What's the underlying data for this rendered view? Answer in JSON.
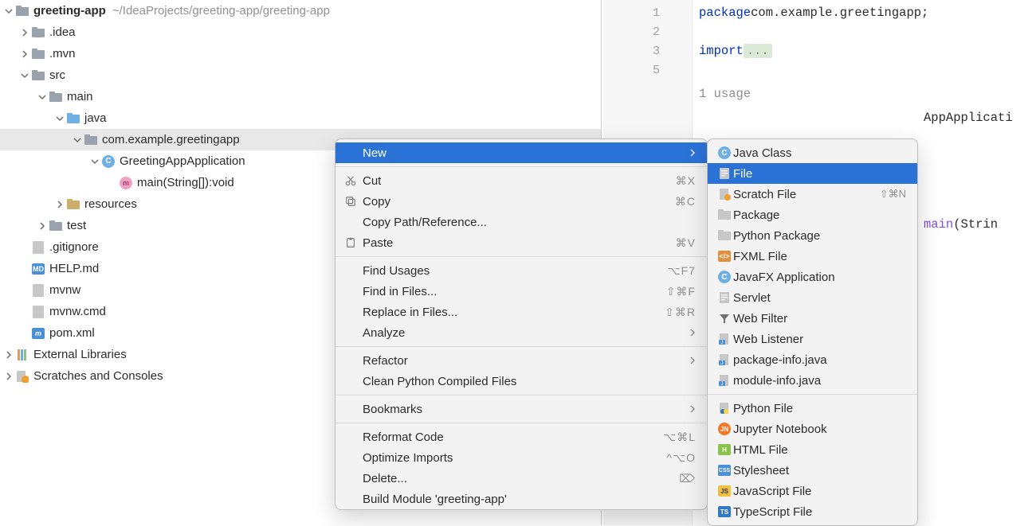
{
  "tree": {
    "root": {
      "name": "greeting-app",
      "path": "~/IdeaProjects/greeting-app/greeting-app"
    },
    "items": [
      {
        "label": ".idea"
      },
      {
        "label": ".mvn"
      },
      {
        "label": "src"
      },
      {
        "label": "main"
      },
      {
        "label": "java"
      },
      {
        "label": "com.example.greetingapp"
      },
      {
        "label": "GreetingAppApplication"
      },
      {
        "label": "main(String[]):void"
      },
      {
        "label": "resources"
      },
      {
        "label": "test"
      },
      {
        "label": ".gitignore"
      },
      {
        "label": "HELP.md"
      },
      {
        "label": "mvnw"
      },
      {
        "label": "mvnw.cmd"
      },
      {
        "label": "pom.xml"
      },
      {
        "label": "External Libraries"
      },
      {
        "label": "Scratches and Consoles"
      }
    ]
  },
  "editor": {
    "lines": [
      "1",
      "2",
      "3",
      "5"
    ],
    "code": {
      "l1a": "package",
      "l1b": " com.example.greetingapp;",
      "l3a": "import ",
      "l3b": "...",
      "usage": "1 usage",
      "l6": "AppApplicati",
      "l8a": " main",
      "l8b": "(Strin"
    }
  },
  "contextMenu": {
    "items": [
      {
        "label": "New",
        "arrow": true,
        "highlight": true
      },
      {
        "sep": true
      },
      {
        "label": "Cut",
        "shortcut": "⌘X",
        "icon": "cut"
      },
      {
        "label": "Copy",
        "shortcut": "⌘C",
        "icon": "copy"
      },
      {
        "label": "Copy Path/Reference..."
      },
      {
        "label": "Paste",
        "shortcut": "⌘V",
        "icon": "paste"
      },
      {
        "sep": true
      },
      {
        "label": "Find Usages",
        "shortcut": "⌥F7"
      },
      {
        "label": "Find in Files...",
        "shortcut": "⇧⌘F"
      },
      {
        "label": "Replace in Files...",
        "shortcut": "⇧⌘R"
      },
      {
        "label": "Analyze",
        "arrow": true
      },
      {
        "sep": true
      },
      {
        "label": "Refactor",
        "arrow": true
      },
      {
        "label": "Clean Python Compiled Files"
      },
      {
        "sep": true
      },
      {
        "label": "Bookmarks",
        "arrow": true
      },
      {
        "sep": true
      },
      {
        "label": "Reformat Code",
        "shortcut": "⌥⌘L"
      },
      {
        "label": "Optimize Imports",
        "shortcut": "^⌥O"
      },
      {
        "label": "Delete...",
        "shortcut": "⌦"
      },
      {
        "label": "Build Module 'greeting-app'"
      }
    ]
  },
  "submenu": {
    "items": [
      {
        "label": "Java Class",
        "icon": "c-circ"
      },
      {
        "label": "File",
        "highlight": true,
        "icon": "file"
      },
      {
        "label": "Scratch File",
        "shortcut": "⇧⌘N",
        "icon": "file-dot"
      },
      {
        "label": "Package",
        "icon": "pkg"
      },
      {
        "label": "Python Package",
        "icon": "pkg"
      },
      {
        "label": "FXML File",
        "icon": "fxml"
      },
      {
        "label": "JavaFX Application",
        "icon": "c-circ"
      },
      {
        "label": "Servlet",
        "icon": "file"
      },
      {
        "label": "Web Filter",
        "icon": "filter"
      },
      {
        "label": "Web Listener",
        "icon": "file-j"
      },
      {
        "label": "package-info.java",
        "icon": "file-j"
      },
      {
        "label": "module-info.java",
        "icon": "file-j"
      },
      {
        "sep": true
      },
      {
        "label": "Python File",
        "icon": "py"
      },
      {
        "label": "Jupyter Notebook",
        "icon": "jup"
      },
      {
        "label": "HTML File",
        "icon": "html"
      },
      {
        "label": "Stylesheet",
        "icon": "css"
      },
      {
        "label": "JavaScript File",
        "icon": "js"
      },
      {
        "label": "TypeScript File",
        "icon": "ts"
      }
    ]
  }
}
